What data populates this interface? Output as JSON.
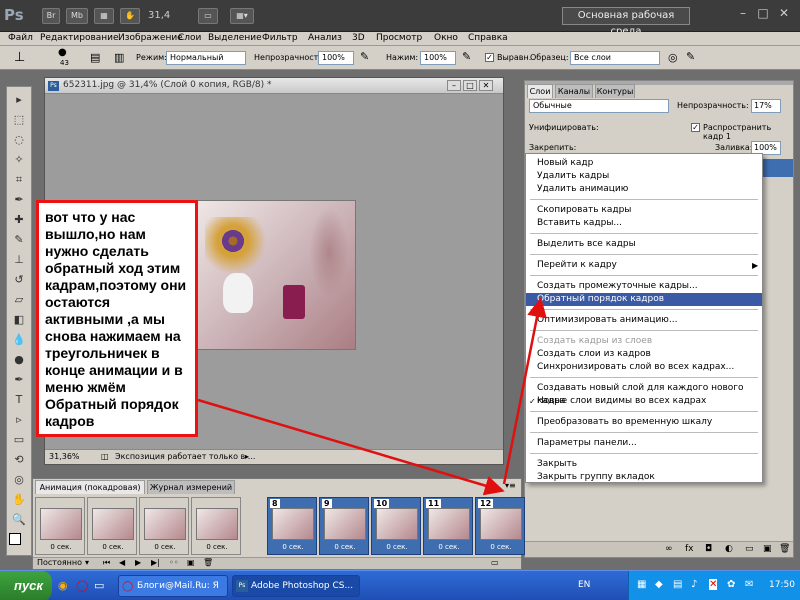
{
  "app": {
    "logo": "Ps",
    "zoom": "31,4",
    "workspace": "Основная рабочая среда",
    "win_buttons": [
      "–",
      "□",
      "✕"
    ],
    "bar_buttons": [
      "Br",
      "Mb",
      "▦",
      "✋",
      "▭",
      "▦▾"
    ]
  },
  "menu": [
    "Файл",
    "Редактирование",
    "Изображение",
    "Слои",
    "Выделение",
    "Фильтр",
    "Анализ",
    "3D",
    "Просмотр",
    "Окно",
    "Справка"
  ],
  "options": {
    "brush_size": "43",
    "mode_label": "Режим:",
    "mode_value": "Нормальный",
    "opacity_label": "Непрозрачность:",
    "opacity_value": "100%",
    "pressure_label": "Нажим:",
    "pressure_value": "100%",
    "aligned_label": "Выравн.",
    "sample_label": "Образец:",
    "sample_value": "Все слои"
  },
  "document": {
    "title": "652311.jpg @ 31,4% (Слой 0 копия, RGB/8) *",
    "zoom": "31,36%",
    "status": "Экспозиция работает только в ..."
  },
  "annotation": "вот что у нас вышло,но нам нужно сделать обратный ход этим кадрам,поэтому они остаются активными ,а мы снова нажимаем на треугольничек в конце анимации и в меню жмём Обратный порядок кадров",
  "layers": {
    "tabs": [
      "Слои",
      "Каналы",
      "Контуры"
    ],
    "blend_mode": "Обычные",
    "opacity_label": "Непрозрачность:",
    "opacity_value": "17%",
    "unify_label": "Унифицировать:",
    "propagate_label": "Распространить кадр 1",
    "lock_label": "Закрепить:",
    "fill_label": "Заливка:",
    "fill_value": "100%"
  },
  "context_menu": [
    {
      "label": "Новый кадр"
    },
    {
      "label": "Удалить кадры"
    },
    {
      "label": "Удалить анимацию"
    },
    {
      "label": "Скопировать кадры"
    },
    {
      "label": "Вставить кадры..."
    },
    {
      "label": "Выделить все кадры"
    },
    {
      "label": "Перейти к кадру"
    },
    {
      "label": "Создать промежуточные кадры..."
    },
    {
      "label": "Обратный порядок кадров"
    },
    {
      "label": "Оптимизировать анимацию..."
    },
    {
      "label": "Создать кадры из слоев"
    },
    {
      "label": "Создать слои из кадров"
    },
    {
      "label": "Синхронизировать слой во всех кадрах..."
    },
    {
      "label": "Создавать новый слой для каждого нового кадра"
    },
    {
      "label": "Новые слои видимы во всех кадрах"
    },
    {
      "label": "Преобразовать во временную шкалу"
    },
    {
      "label": "Параметры панели..."
    },
    {
      "label": "Закрыть"
    },
    {
      "label": "Закрыть группу вкладок"
    }
  ],
  "animation": {
    "tabs": [
      "Анимация (покадровая)",
      "Журнал измерений"
    ],
    "loop": "Постоянно",
    "frames": [
      {
        "num": "",
        "delay": "0 сек."
      },
      {
        "num": "",
        "delay": "0 сек."
      },
      {
        "num": "",
        "delay": "0 сек."
      },
      {
        "num": "",
        "delay": "0 сек."
      },
      {
        "num": "8",
        "delay": "0 сек."
      },
      {
        "num": "9",
        "delay": "0 сек."
      },
      {
        "num": "10",
        "delay": "0 сек."
      },
      {
        "num": "11",
        "delay": "0 сек."
      },
      {
        "num": "12",
        "delay": "0 сек."
      }
    ]
  },
  "taskbar": {
    "start": "пуск",
    "tasks": [
      "Блоги@Mail.Ru: Я со...",
      "Adobe Photoshop CS..."
    ],
    "lang": "EN",
    "clock": "17:50"
  },
  "colors": {
    "highlight": "#3a5aa6",
    "annotation_border": "#e11111",
    "arrow": "#e01010"
  }
}
